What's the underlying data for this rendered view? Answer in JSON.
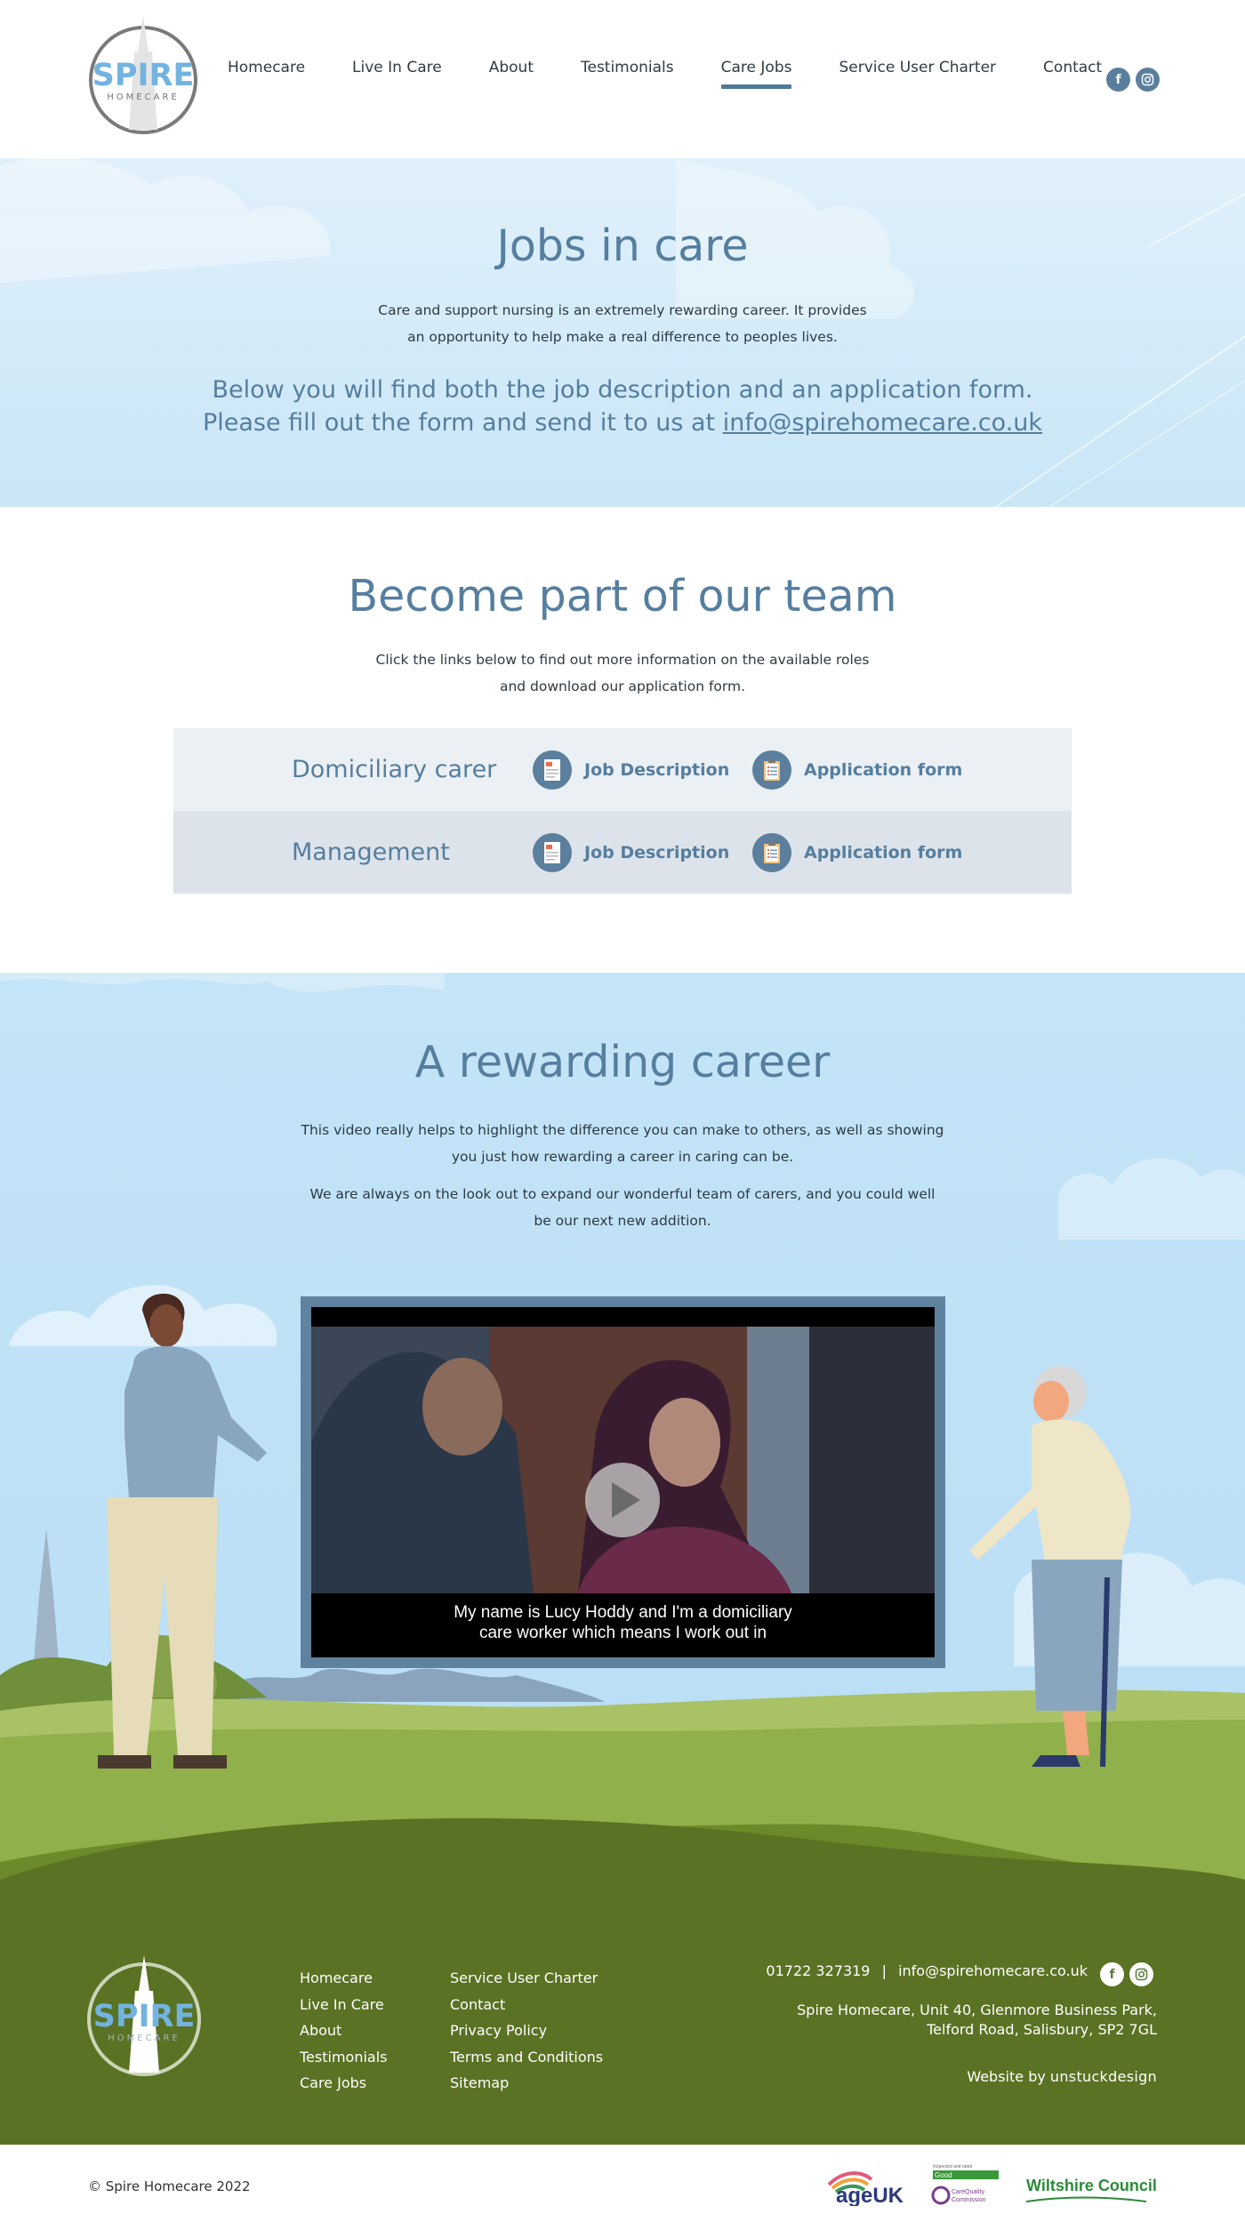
{
  "brand": {
    "logo_word": "SPIRE",
    "logo_sub": "HOMECARE"
  },
  "nav": {
    "items": [
      {
        "label": "Homecare"
      },
      {
        "label": "Live In Care"
      },
      {
        "label": "About"
      },
      {
        "label": "Testimonials"
      },
      {
        "label": "Care Jobs",
        "active": true
      },
      {
        "label": "Service User Charter"
      },
      {
        "label": "Contact"
      }
    ],
    "social": [
      "facebook-icon",
      "instagram-icon"
    ]
  },
  "hero": {
    "title": "Jobs in care",
    "intro_line1": "Care and support nursing is an extremely rewarding career. It provides",
    "intro_line2": "an opportunity to help make a real difference to peoples lives.",
    "lead_line1": "Below you will find both the job description and an application form.",
    "lead_line2_prefix": "Please fill out the form  and send it to us at ",
    "lead_email": "info@spirehomecare.co.uk"
  },
  "team": {
    "title": "Become part of our team",
    "intro_line1": "Click the links below to find out more information on the available roles",
    "intro_line2": "and download our application form.",
    "rows": [
      {
        "role": "Domiciliary carer",
        "job_description": "Job Description",
        "application": "Application form"
      },
      {
        "role": "Management",
        "job_description": "Job Description",
        "application": "Application form"
      }
    ]
  },
  "career": {
    "title": "A rewarding career",
    "p1_line1": "This video really helps to highlight the difference you can make to others, as well as showing",
    "p1_line2": "you just how rewarding a career in caring can be.",
    "p2_line1": "We are always on the look out to expand our wonderful team of carers, and you could well",
    "p2_line2": "be our next new addition.",
    "video_caption_line1": "My name is Lucy Hoddy and I'm a domiciliary",
    "video_caption_line2": "care worker which means I work out in"
  },
  "footer": {
    "col1": [
      "Homecare",
      "Live In Care",
      "About",
      "Testimonials",
      "Care Jobs"
    ],
    "col2": [
      "Service User Charter",
      "Contact",
      "Privacy Policy",
      "Terms and Conditions",
      "Sitemap"
    ],
    "phone": "01722 327319",
    "separator": "|",
    "email": "info@spirehomecare.co.uk",
    "address_line1": "Spire Homecare, Unit 40, Glenmore Business Park,",
    "address_line2": "Telford Road, Salisbury, SP2 7GL",
    "website_by": "Website by",
    "agency": "unstuckdesign",
    "copyright": "© Spire Homecare 2022"
  },
  "partners": {
    "ageuk": "ageUK",
    "cqc_small": "Inspected and rated",
    "cqc_rating": "Good",
    "cqc_name1": "CareQuality",
    "cqc_name2": "Commission",
    "wiltshire": "Wiltshire Council"
  },
  "colors": {
    "accent": "#557e9f",
    "footer_green": "#5a7223",
    "sky": "#bfe2f7"
  }
}
